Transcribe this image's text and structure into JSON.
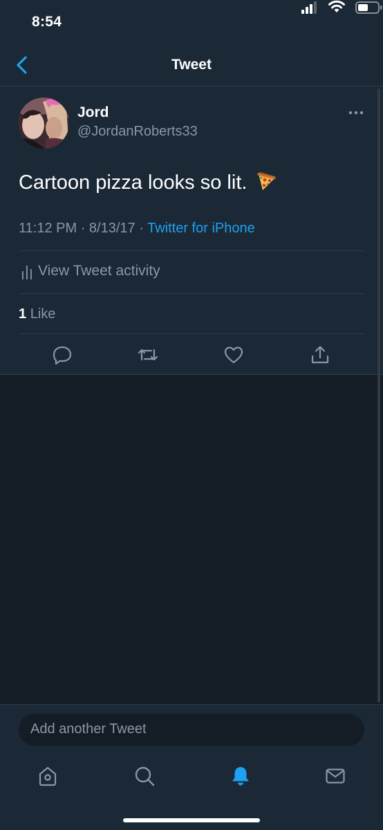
{
  "status_bar": {
    "time": "8:54"
  },
  "nav": {
    "title": "Tweet"
  },
  "tweet": {
    "author_name": "Jord",
    "author_handle": "@JordanRoberts33",
    "text": "Cartoon pizza looks so lit.",
    "emoji": "pizza-icon",
    "time": "11:12 PM",
    "date": "8/13/17",
    "separator": "·",
    "source": "Twitter for iPhone",
    "activity_label": "View Tweet activity",
    "like_count": "1",
    "like_label": "Like"
  },
  "compose": {
    "placeholder": "Add another Tweet"
  },
  "icons": {
    "back": "chevron-left-icon",
    "more": "more-horizontal-icon",
    "reply": "reply-icon",
    "retweet": "retweet-icon",
    "like": "heart-icon",
    "share": "share-icon",
    "home": "home-icon",
    "search": "search-icon",
    "notifications": "bell-icon",
    "messages": "mail-icon"
  },
  "colors": {
    "background": "#141d26",
    "surface": "#1b2836",
    "accent": "#1da1f2",
    "secondary_text": "#8899a6"
  },
  "tab_bar": {
    "active_tab": "notifications"
  }
}
